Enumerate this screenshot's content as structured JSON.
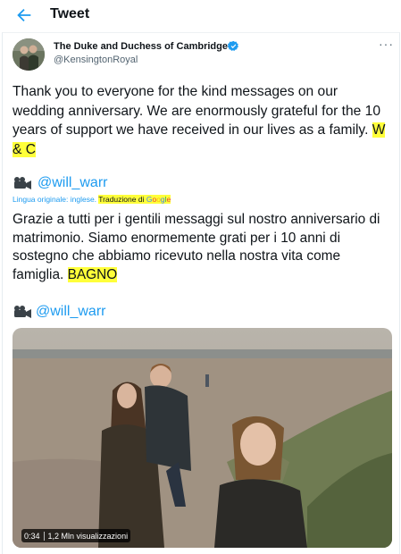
{
  "header": {
    "title": "Tweet"
  },
  "author": {
    "name": "The Duke and Duchess of Cambridge",
    "handle": "@KensingtonRoyal"
  },
  "tweet": {
    "text": "Thank you to everyone for the kind messages on our wedding anniversary. We are enormously grateful for the 10 years of support we have received in our lives as a family.",
    "signature": "W & C",
    "mention_1": "@will_warr",
    "translation_prefix": "Lingua originale: inglese.",
    "translation_label": "Traduzione di",
    "google_letters": [
      "G",
      "o",
      "o",
      "g",
      "l",
      "e"
    ],
    "translated_text": "Grazie a tutti per i gentili messaggi sul nostro anniversario di matrimonio. Siamo enormemente grati per i 10 anni di sostegno che abbiamo ricevuto nella nostra vita come famiglia.",
    "translated_signature": "BAGNO",
    "mention_2": "@will_warr"
  },
  "video": {
    "duration": "0:34",
    "views": "1,2 Mln visualizzazioni"
  },
  "colors": {
    "accent": "#1d9bf0",
    "highlight": "#ffff3a",
    "text": "#0f1419",
    "secondary": "#536471"
  },
  "icons": [
    "back-arrow-icon",
    "verified-badge-icon",
    "more-options-icon",
    "video-camera-icon"
  ]
}
